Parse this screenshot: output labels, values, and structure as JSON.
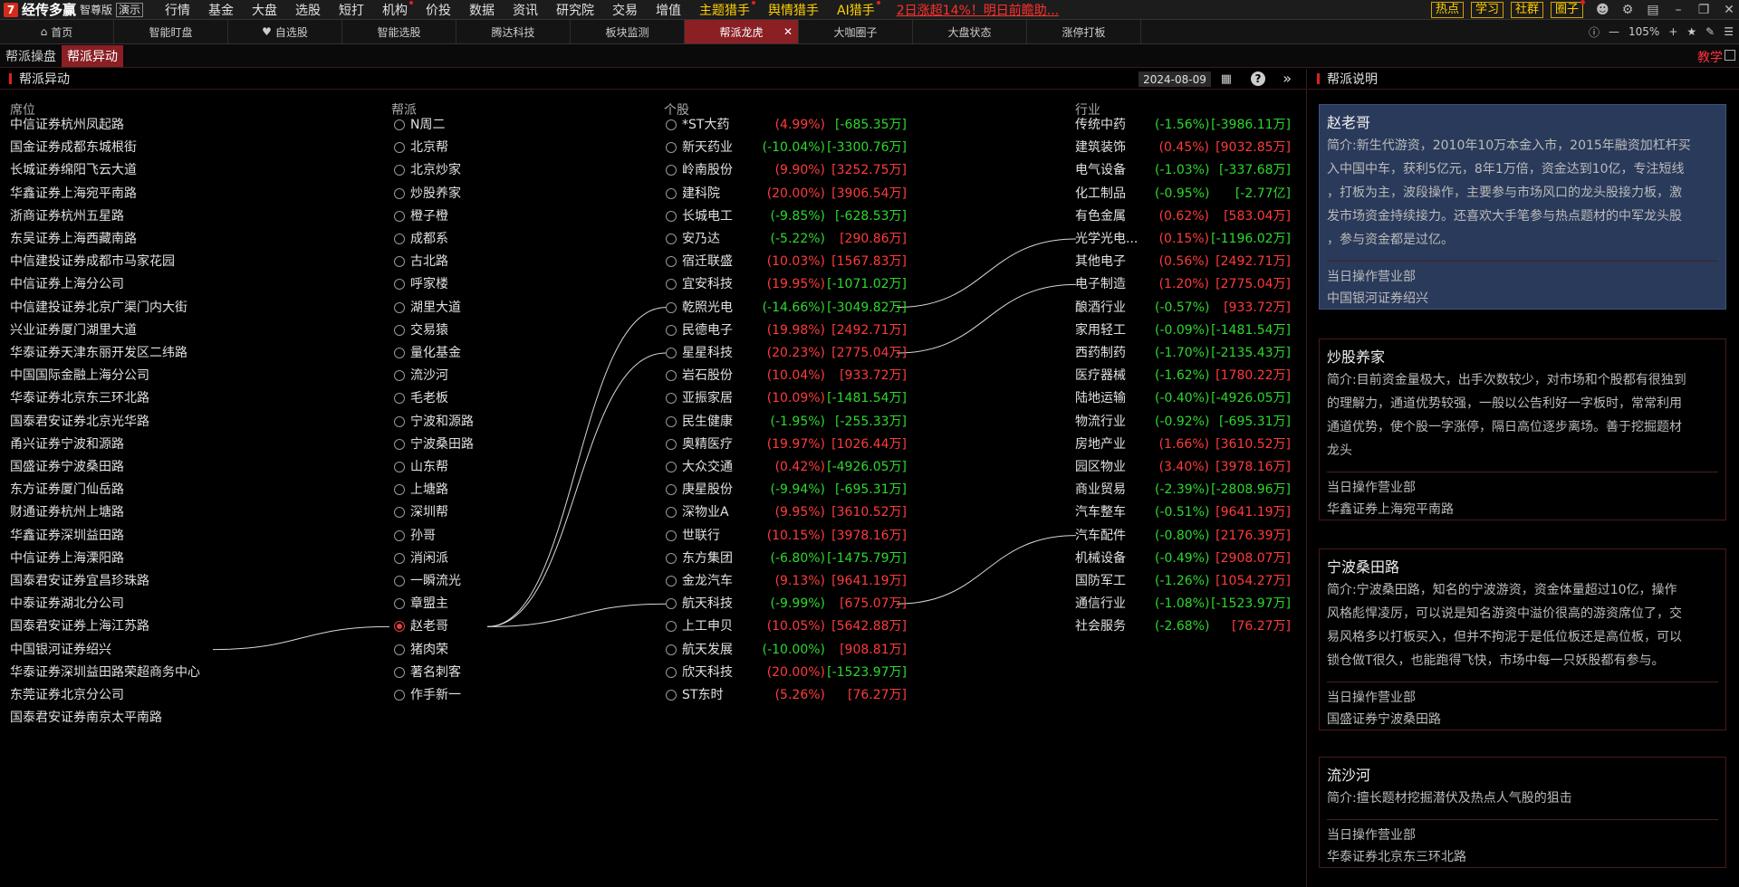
{
  "app": {
    "logo_text": "经传多赢",
    "edition": "智尊版",
    "demo": "演示",
    "menu": [
      {
        "label": "行情",
        "dot": false,
        "hot": false
      },
      {
        "label": "基金",
        "dot": false,
        "hot": false
      },
      {
        "label": "大盘",
        "dot": false,
        "hot": false
      },
      {
        "label": "选股",
        "dot": false,
        "hot": false
      },
      {
        "label": "短打",
        "dot": false,
        "hot": false
      },
      {
        "label": "机构",
        "dot": true,
        "hot": false
      },
      {
        "label": "价投",
        "dot": false,
        "hot": false
      },
      {
        "label": "数据",
        "dot": false,
        "hot": false
      },
      {
        "label": "资讯",
        "dot": false,
        "hot": false
      },
      {
        "label": "研究院",
        "dot": false,
        "hot": false
      },
      {
        "label": "交易",
        "dot": false,
        "hot": false
      },
      {
        "label": "增值",
        "dot": false,
        "hot": false
      },
      {
        "label": "主题猎手",
        "dot": true,
        "hot": true
      },
      {
        "label": "舆情猎手",
        "dot": false,
        "hot": true
      },
      {
        "label": "AI猎手",
        "dot": true,
        "hot": true
      }
    ],
    "ad_text": "2日涨超14%！明日前瞻助...",
    "top_buttons": [
      {
        "label": "热点",
        "dot": false
      },
      {
        "label": "学习",
        "dot": false
      },
      {
        "label": "社群",
        "dot": false
      },
      {
        "label": "圈子",
        "dot": true
      }
    ]
  },
  "tabs": [
    {
      "label": "首页",
      "icon": "home-icon",
      "active": false
    },
    {
      "label": "智能盯盘",
      "active": false
    },
    {
      "label": "自选股",
      "icon": "heart-icon",
      "active": false
    },
    {
      "label": "智能选股",
      "active": false
    },
    {
      "label": "腾达科技",
      "active": false
    },
    {
      "label": "板块监测",
      "active": false
    },
    {
      "label": "帮派龙虎",
      "active": true
    },
    {
      "label": "大咖圈子",
      "active": false
    },
    {
      "label": "大盘状态",
      "active": false
    },
    {
      "label": "涨停打板",
      "active": false
    }
  ],
  "zoom": "105%",
  "subtabs": [
    {
      "label": "帮派操盘",
      "active": false
    },
    {
      "label": "帮派异动",
      "active": true
    }
  ],
  "teach_label": "教学",
  "main": {
    "title": "帮派异动",
    "date": "2024-08-09",
    "headers": {
      "seat": "席位",
      "gang": "帮派",
      "stock": "个股",
      "industry": "行业"
    },
    "seats": [
      "中信证券杭州凤起路",
      "国金证券成都东城根街",
      "长城证券绵阳飞云大道",
      "华鑫证券上海宛平南路",
      "浙商证券杭州五星路",
      "东吴证券上海西藏南路",
      "中信建投证券成都市马家花园",
      "中信证券上海分公司",
      "中信建投证券北京广渠门内大街",
      "兴业证券厦门湖里大道",
      "华泰证券天津东丽开发区二纬路",
      "中国国际金融上海分公司",
      "华泰证券北京东三环北路",
      "国泰君安证券北京光华路",
      "甬兴证券宁波和源路",
      "国盛证券宁波桑田路",
      "东方证券厦门仙岳路",
      "财通证券杭州上塘路",
      "华鑫证券深圳益田路",
      "中信证券上海溧阳路",
      "国泰君安证券宜昌珍珠路",
      "中泰证券湖北分公司",
      "国泰君安证券上海江苏路",
      "中国银河证券绍兴",
      "华泰证券深圳益田路荣超商务中心",
      "东莞证券北京分公司",
      "国泰君安证券南京太平南路"
    ],
    "gangs": [
      {
        "name": "N周二",
        "selected": false
      },
      {
        "name": "北京帮",
        "selected": false
      },
      {
        "name": "北京炒家",
        "selected": false
      },
      {
        "name": "炒股养家",
        "selected": false
      },
      {
        "name": "橙子橙",
        "selected": false
      },
      {
        "name": "成都系",
        "selected": false
      },
      {
        "name": "古北路",
        "selected": false
      },
      {
        "name": "呼家楼",
        "selected": false
      },
      {
        "name": "湖里大道",
        "selected": false
      },
      {
        "name": "交易猿",
        "selected": false
      },
      {
        "name": "量化基金",
        "selected": false
      },
      {
        "name": "流沙河",
        "selected": false
      },
      {
        "name": "毛老板",
        "selected": false
      },
      {
        "name": "宁波和源路",
        "selected": false
      },
      {
        "name": "宁波桑田路",
        "selected": false
      },
      {
        "name": "山东帮",
        "selected": false
      },
      {
        "name": "上塘路",
        "selected": false
      },
      {
        "name": "深圳帮",
        "selected": false
      },
      {
        "name": "孙哥",
        "selected": false
      },
      {
        "name": "消闲派",
        "selected": false
      },
      {
        "name": "一瞬流光",
        "selected": false
      },
      {
        "name": "章盟主",
        "selected": false
      },
      {
        "name": "赵老哥",
        "selected": true
      },
      {
        "name": "猪肉荣",
        "selected": false
      },
      {
        "name": "著名刺客",
        "selected": false
      },
      {
        "name": "作手新一",
        "selected": false
      }
    ],
    "stocks": [
      {
        "name": "*ST大药",
        "pct": "(4.99%)",
        "amt": "[-685.35万]",
        "pct_up": true,
        "amt_up": false
      },
      {
        "name": "新天药业",
        "pct": "(-10.04%)",
        "amt": "[-3300.76万]",
        "pct_up": false,
        "amt_up": false
      },
      {
        "name": "岭南股份",
        "pct": "(9.90%)",
        "amt": "[3252.75万]",
        "pct_up": true,
        "amt_up": true
      },
      {
        "name": "建科院",
        "pct": "(20.00%)",
        "amt": "[3906.54万]",
        "pct_up": true,
        "amt_up": true
      },
      {
        "name": "长城电工",
        "pct": "(-9.85%)",
        "amt": "[-628.53万]",
        "pct_up": false,
        "amt_up": false
      },
      {
        "name": "安乃达",
        "pct": "(-5.22%)",
        "amt": "[290.86万]",
        "pct_up": false,
        "amt_up": true
      },
      {
        "name": "宿迁联盛",
        "pct": "(10.03%)",
        "amt": "[1567.83万]",
        "pct_up": true,
        "amt_up": true
      },
      {
        "name": "宜安科技",
        "pct": "(19.95%)",
        "amt": "[-1071.02万]",
        "pct_up": true,
        "amt_up": false
      },
      {
        "name": "乾照光电",
        "pct": "(-14.66%)",
        "amt": "[-3049.82万]",
        "pct_up": false,
        "amt_up": false
      },
      {
        "name": "民德电子",
        "pct": "(19.98%)",
        "amt": "[2492.71万]",
        "pct_up": true,
        "amt_up": true
      },
      {
        "name": "星星科技",
        "pct": "(20.23%)",
        "amt": "[2775.04万]",
        "pct_up": true,
        "amt_up": true
      },
      {
        "name": "岩石股份",
        "pct": "(10.04%)",
        "amt": "[933.72万]",
        "pct_up": true,
        "amt_up": true
      },
      {
        "name": "亚振家居",
        "pct": "(10.09%)",
        "amt": "[-1481.54万]",
        "pct_up": true,
        "amt_up": false
      },
      {
        "name": "民生健康",
        "pct": "(-1.95%)",
        "amt": "[-255.33万]",
        "pct_up": false,
        "amt_up": false
      },
      {
        "name": "奥精医疗",
        "pct": "(19.97%)",
        "amt": "[1026.44万]",
        "pct_up": true,
        "amt_up": true
      },
      {
        "name": "大众交通",
        "pct": "(0.42%)",
        "amt": "[-4926.05万]",
        "pct_up": true,
        "amt_up": false
      },
      {
        "name": "庚星股份",
        "pct": "(-9.94%)",
        "amt": "[-695.31万]",
        "pct_up": false,
        "amt_up": false
      },
      {
        "name": "深物业A",
        "pct": "(9.95%)",
        "amt": "[3610.52万]",
        "pct_up": true,
        "amt_up": true
      },
      {
        "name": "世联行",
        "pct": "(10.15%)",
        "amt": "[3978.16万]",
        "pct_up": true,
        "amt_up": true
      },
      {
        "name": "东方集团",
        "pct": "(-6.80%)",
        "amt": "[-1475.79万]",
        "pct_up": false,
        "amt_up": false
      },
      {
        "name": "金龙汽车",
        "pct": "(9.13%)",
        "amt": "[9641.19万]",
        "pct_up": true,
        "amt_up": true
      },
      {
        "name": "航天科技",
        "pct": "(-9.99%)",
        "amt": "[675.07万]",
        "pct_up": false,
        "amt_up": true
      },
      {
        "name": "上工申贝",
        "pct": "(10.05%)",
        "amt": "[5642.88万]",
        "pct_up": true,
        "amt_up": true
      },
      {
        "name": "航天发展",
        "pct": "(-10.00%)",
        "amt": "[908.81万]",
        "pct_up": false,
        "amt_up": true
      },
      {
        "name": "欣天科技",
        "pct": "(20.00%)",
        "amt": "[-1523.97万]",
        "pct_up": true,
        "amt_up": false
      },
      {
        "name": "ST东时",
        "pct": "(5.26%)",
        "amt": "[76.27万]",
        "pct_up": true,
        "amt_up": true
      }
    ],
    "industries": [
      {
        "name": "传统中药",
        "pct": "(-1.56%)",
        "amt": "[-3986.11万]",
        "pct_up": false,
        "amt_up": false
      },
      {
        "name": "建筑装饰",
        "pct": "(0.45%)",
        "amt": "[9032.85万]",
        "pct_up": true,
        "amt_up": true
      },
      {
        "name": "电气设备",
        "pct": "(-1.03%)",
        "amt": "[-337.68万]",
        "pct_up": false,
        "amt_up": false
      },
      {
        "name": "化工制品",
        "pct": "(-0.95%)",
        "amt": "[-2.77亿]",
        "pct_up": false,
        "amt_up": false
      },
      {
        "name": "有色金属",
        "pct": "(0.62%)",
        "amt": "[583.04万]",
        "pct_up": true,
        "amt_up": true
      },
      {
        "name": "光学光电...",
        "pct": "(0.15%)",
        "amt": "[-1196.02万]",
        "pct_up": true,
        "amt_up": false
      },
      {
        "name": "其他电子",
        "pct": "(0.56%)",
        "amt": "[2492.71万]",
        "pct_up": true,
        "amt_up": true
      },
      {
        "name": "电子制造",
        "pct": "(1.20%)",
        "amt": "[2775.04万]",
        "pct_up": true,
        "amt_up": true
      },
      {
        "name": "酿酒行业",
        "pct": "(-0.57%)",
        "amt": "[933.72万]",
        "pct_up": false,
        "amt_up": true
      },
      {
        "name": "家用轻工",
        "pct": "(-0.09%)",
        "amt": "[-1481.54万]",
        "pct_up": false,
        "amt_up": false
      },
      {
        "name": "西药制药",
        "pct": "(-1.70%)",
        "amt": "[-2135.43万]",
        "pct_up": false,
        "amt_up": false
      },
      {
        "name": "医疗器械",
        "pct": "(-1.62%)",
        "amt": "[1780.22万]",
        "pct_up": false,
        "amt_up": true
      },
      {
        "name": "陆地运输",
        "pct": "(-0.40%)",
        "amt": "[-4926.05万]",
        "pct_up": false,
        "amt_up": false
      },
      {
        "name": "物流行业",
        "pct": "(-0.92%)",
        "amt": "[-695.31万]",
        "pct_up": false,
        "amt_up": false
      },
      {
        "name": "房地产业",
        "pct": "(1.66%)",
        "amt": "[3610.52万]",
        "pct_up": true,
        "amt_up": true
      },
      {
        "name": "园区物业",
        "pct": "(3.40%)",
        "amt": "[3978.16万]",
        "pct_up": true,
        "amt_up": true
      },
      {
        "name": "商业贸易",
        "pct": "(-2.39%)",
        "amt": "[-2808.96万]",
        "pct_up": false,
        "amt_up": false
      },
      {
        "name": "汽车整车",
        "pct": "(-0.51%)",
        "amt": "[9641.19万]",
        "pct_up": false,
        "amt_up": true
      },
      {
        "name": "汽车配件",
        "pct": "(-0.80%)",
        "amt": "[2176.39万]",
        "pct_up": false,
        "amt_up": true
      },
      {
        "name": "机械设备",
        "pct": "(-0.49%)",
        "amt": "[2908.07万]",
        "pct_up": false,
        "amt_up": true
      },
      {
        "name": "国防军工",
        "pct": "(-1.26%)",
        "amt": "[1054.27万]",
        "pct_up": false,
        "amt_up": true
      },
      {
        "name": "通信行业",
        "pct": "(-1.08%)",
        "amt": "[-1523.97万]",
        "pct_up": false,
        "amt_up": false
      },
      {
        "name": "社会服务",
        "pct": "(-2.68%)",
        "amt": "[76.27万]",
        "pct_up": false,
        "amt_up": true
      }
    ],
    "links": {
      "seat_to_gang": [
        [
          23,
          22
        ]
      ],
      "gang_to_stock": [
        [
          22,
          8
        ],
        [
          22,
          10
        ],
        [
          22,
          21
        ]
      ],
      "stock_to_industry": [
        [
          8,
          5
        ],
        [
          10,
          7
        ],
        [
          21,
          18
        ]
      ]
    }
  },
  "side": {
    "title": "帮派说明",
    "cards": [
      {
        "name": "赵老哥",
        "active": true,
        "desc_lines": [
          "简介:新生代游资，2010年10万本金入市，2015年融资加杠杆买",
          "入中国中车，获利5亿元，8年1万倍，资金达到10亿，专注短线",
          "，打板为主，波段操作，主要参与市场风口的龙头股接力板，激",
          "发市场资金持续接力。还喜欢大手笔参与热点题材的中军龙头股",
          "，参与资金都是过亿。"
        ],
        "op_label": "当日操作营业部",
        "branch": "中国银河证券绍兴"
      },
      {
        "name": "炒股养家",
        "active": false,
        "desc_lines": [
          "简介:目前资金量极大，出手次数较少，对市场和个股都有很独到",
          "的理解力，通道优势较强，一般以公告利好一字板时，常常利用",
          "通道优势，使个股一字涨停，隔日高位逐步离场。善于挖掘题材",
          "龙头"
        ],
        "op_label": "当日操作营业部",
        "branch": "华鑫证券上海宛平南路"
      },
      {
        "name": "宁波桑田路",
        "active": false,
        "desc_lines": [
          "简介:宁波桑田路，知名的宁波游资，资金体量超过10亿，操作",
          "风格彪悍凌厉，可以说是知名游资中溢价很高的游资席位了，交",
          "易风格多以打板买入，但并不拘泥于是低位板还是高位板，可以",
          "锁仓做T很久，也能跑得飞快，市场中每一只妖股都有参与。"
        ],
        "op_label": "当日操作营业部",
        "branch": "国盛证券宁波桑田路"
      },
      {
        "name": "流沙河",
        "active": false,
        "desc_lines": [
          "简介:擅长题材挖掘潜伏及热点人气股的狙击"
        ],
        "op_label": "当日操作营业部",
        "branch": "华泰证券北京东三环北路"
      }
    ]
  }
}
